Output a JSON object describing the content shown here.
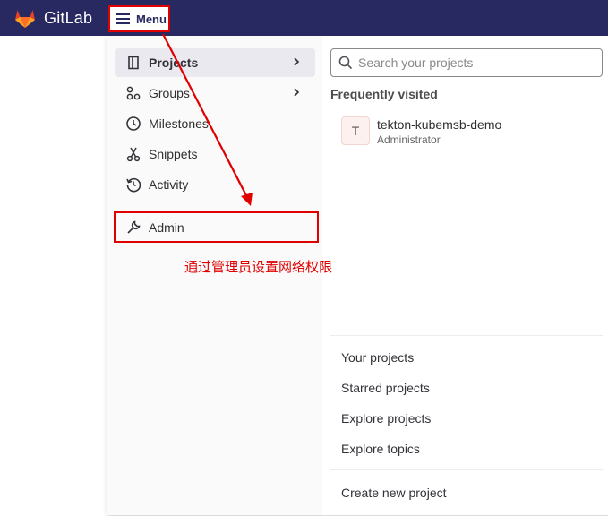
{
  "topbar": {
    "brand": "GitLab",
    "menu_label": "Menu"
  },
  "nav": {
    "items": [
      {
        "label": "Projects",
        "icon": "project-icon",
        "has_chevron": true,
        "active": true
      },
      {
        "label": "Groups",
        "icon": "group-icon",
        "has_chevron": true,
        "active": false
      },
      {
        "label": "Milestones",
        "icon": "clock-icon",
        "has_chevron": false,
        "active": false
      },
      {
        "label": "Snippets",
        "icon": "scissors-icon",
        "has_chevron": false,
        "active": false
      },
      {
        "label": "Activity",
        "icon": "history-icon",
        "has_chevron": false,
        "active": false
      }
    ],
    "admin_label": "Admin"
  },
  "projects_panel": {
    "search_placeholder": "Search your projects",
    "frequently_visited_title": "Frequently visited",
    "frequent": [
      {
        "avatar_letter": "T",
        "name": "tekton-kubemsb-demo",
        "namespace": "Administrator"
      }
    ],
    "links": [
      "Your projects",
      "Starred projects",
      "Explore projects",
      "Explore topics"
    ],
    "create_label": "Create new project"
  },
  "annotation": {
    "text": "通过管理员设置网络权限",
    "color": "#e00000"
  },
  "colors": {
    "topbar": "#292961",
    "highlight": "#e00000",
    "logo_orange": "#fc6d26"
  }
}
